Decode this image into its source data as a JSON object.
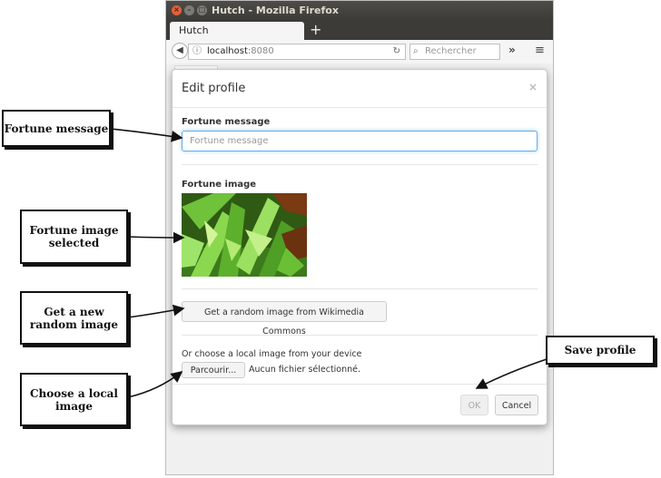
{
  "window": {
    "title": "Hutch - Mozilla Firefox",
    "tab_label": "Hutch",
    "new_tab_glyph": "+",
    "url_host": "localhost",
    "url_port": ":8080",
    "search_placeholder": "Rechercher",
    "overflow_glyph": "»",
    "menu_glyph": "≡",
    "back_glyph": "◀",
    "info_glyph": "ⓘ",
    "reload_glyph": "↻",
    "search_glyph": "⌕"
  },
  "modal": {
    "title": "Edit profile",
    "close_glyph": "×",
    "fortune_message_label": "Fortune message",
    "fortune_message_placeholder": "Fortune message",
    "fortune_message_value": "",
    "fortune_image_label": "Fortune image",
    "random_button": "Get a random image from Wikimedia Commons",
    "local_text": "Or choose a local image from your device",
    "browse_button": "Parcourir...",
    "no_file": "Aucun fichier sélectionné.",
    "ok_button": "OK",
    "cancel_button": "Cancel"
  },
  "callouts": {
    "fortune_message": "Fortune message",
    "fortune_image": "Fortune image selected",
    "random_image": "Get a new random image",
    "local_image": "Choose a local image",
    "save_profile": "Save profile"
  },
  "colors": {
    "titlebar": "#3c3b37",
    "close_button": "#e5603a",
    "input_focus": "#66afe9"
  }
}
